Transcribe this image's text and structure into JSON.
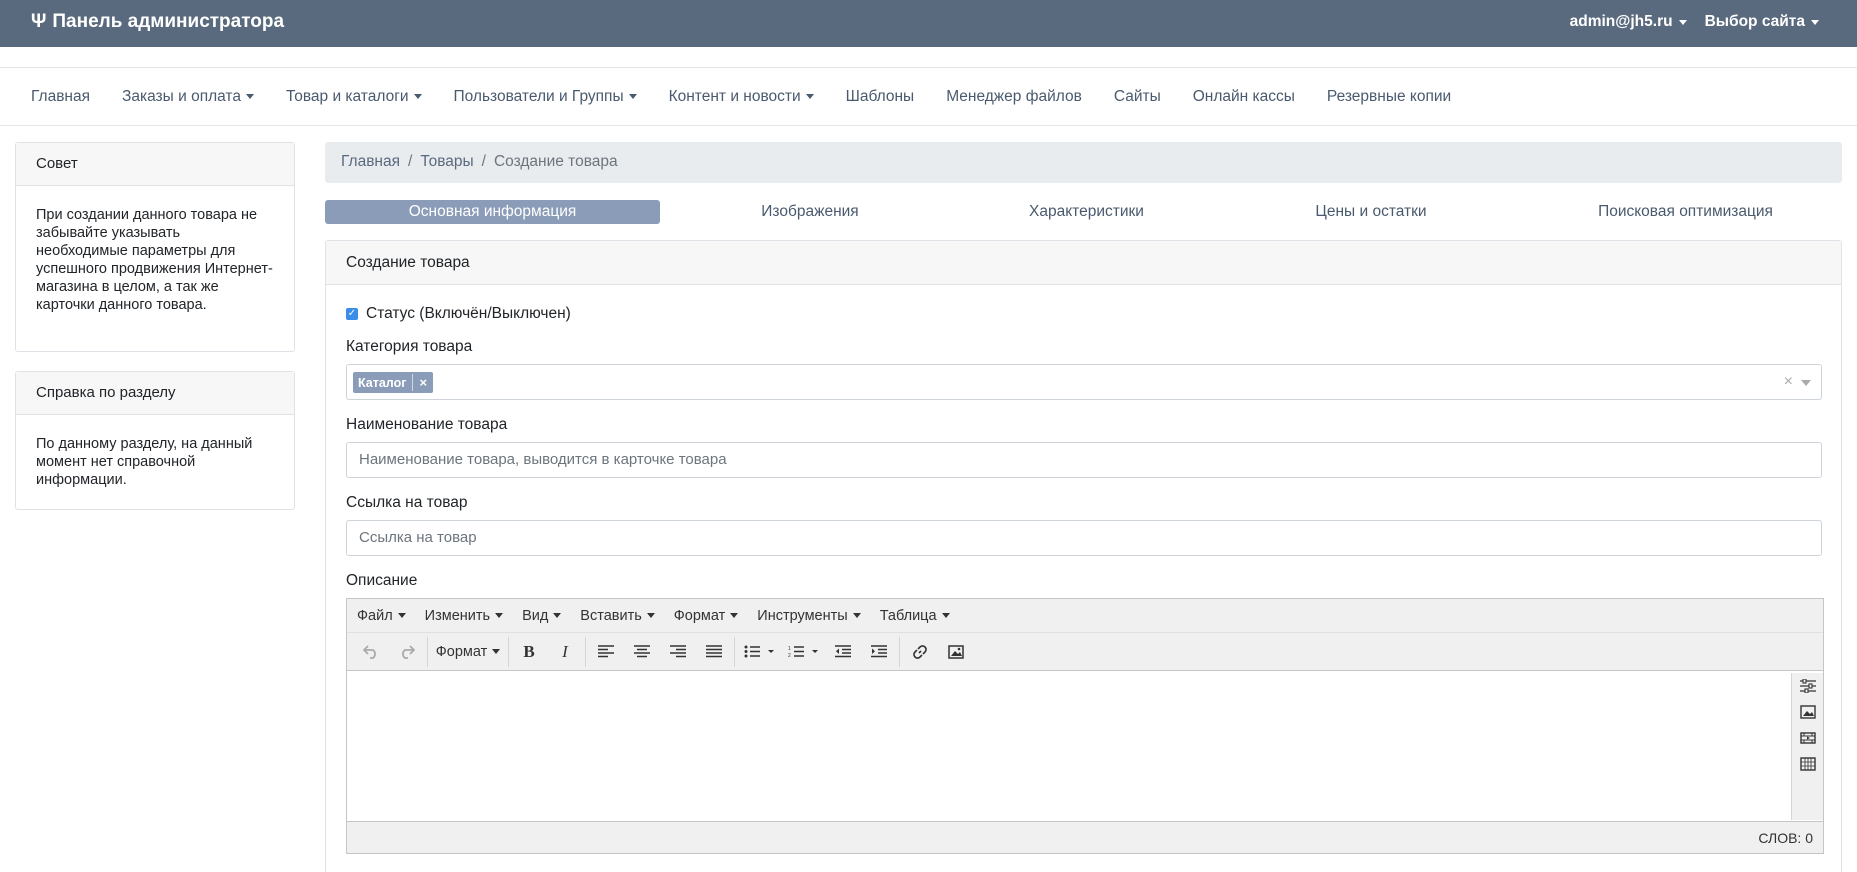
{
  "topbar": {
    "brand_icon": "Ψ",
    "title": "Панель администратора",
    "user": "admin@jh5.ru",
    "site_select": "Выбор сайта",
    "bg_color": "#5a6a7e"
  },
  "nav": [
    {
      "label": "Главная",
      "dropdown": false
    },
    {
      "label": "Заказы и оплата",
      "dropdown": true
    },
    {
      "label": "Товар и каталоги",
      "dropdown": true
    },
    {
      "label": "Пользователи и Группы",
      "dropdown": true
    },
    {
      "label": "Контент и новости",
      "dropdown": true
    },
    {
      "label": "Шаблоны",
      "dropdown": false
    },
    {
      "label": "Менеджер файлов",
      "dropdown": false
    },
    {
      "label": "Сайты",
      "dropdown": false
    },
    {
      "label": "Онлайн кассы",
      "dropdown": false
    },
    {
      "label": "Резервные копии",
      "dropdown": false
    }
  ],
  "sidebar": {
    "tip": {
      "title": "Совет",
      "text": "При создании данного товара не забывайте указывать необходимые параметры для успешного продвижения Интернет-магазина в целом, а так же карточки данного товара."
    },
    "help": {
      "title": "Справка по разделу",
      "text": "По данному разделу, на данный момент нет справочной информации."
    }
  },
  "breadcrumb": {
    "home": "Главная",
    "products": "Товары",
    "current": "Создание товара",
    "separator": "/"
  },
  "tabs": [
    {
      "label": "Основная информация",
      "active": true
    },
    {
      "label": "Изображения",
      "active": false
    },
    {
      "label": "Характеристики",
      "active": false
    },
    {
      "label": "Цены и остатки",
      "active": false
    },
    {
      "label": "Поисковая оптимизация",
      "active": false
    }
  ],
  "form": {
    "title": "Создание товара",
    "status_label": "Статус (Включён/Выключен)",
    "status_checked": true,
    "category_label": "Категория товара",
    "category_tag": "Каталог",
    "tag_remove": "×",
    "clear_all": "×",
    "name_label": "Наименование товара",
    "name_placeholder": "Наименование товара, выводится в карточке товара",
    "link_label": "Ссылка на товар",
    "link_placeholder": "Ссылка на товар",
    "description_label": "Описание"
  },
  "editor": {
    "menu": [
      "Файл",
      "Изменить",
      "Вид",
      "Вставить",
      "Формат",
      "Инструменты",
      "Таблица"
    ],
    "format_button": "Формат",
    "word_count": "СЛОВ: 0",
    "toolbar_icons": [
      "undo-icon",
      "redo-icon",
      "bold-icon",
      "italic-icon",
      "align-left-icon",
      "align-center-icon",
      "align-right-icon",
      "align-justify-icon",
      "bullet-list-icon",
      "numbered-list-icon",
      "outdent-icon",
      "indent-icon",
      "link-icon",
      "image-icon"
    ],
    "side_icons": [
      "settings-sliders-icon",
      "image-icon",
      "video-icon",
      "grid-icon"
    ]
  }
}
